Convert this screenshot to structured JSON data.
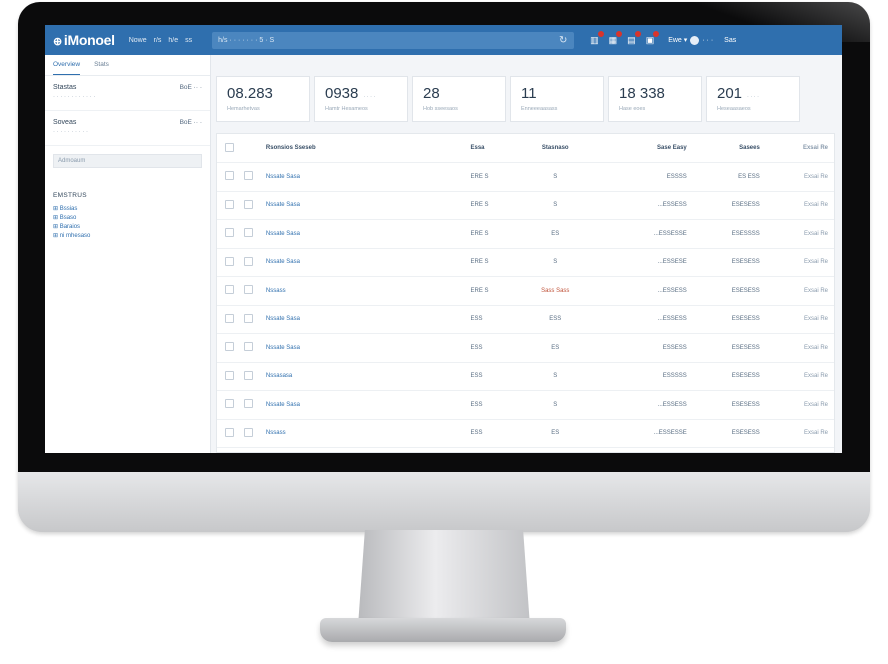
{
  "topbar": {
    "logo": "iMonoel",
    "nav": [
      "Nowe",
      "r/s",
      "h/e",
      "ss"
    ],
    "search_text": "h/s  · · · · · ·  ·  5 · S",
    "icons": [
      {
        "name": "chart-icon",
        "label": "",
        "badge": true
      },
      {
        "name": "grid-icon",
        "label": "",
        "badge": true
      },
      {
        "name": "bell-icon",
        "label": "",
        "badge": true
      },
      {
        "name": "mail-icon",
        "label": "",
        "badge": true
      }
    ],
    "user_label": "Ewe ▾",
    "user_name": "· · ·",
    "extra": "Sas"
  },
  "sidebar": {
    "tabs": [
      "Overview",
      "Stats"
    ],
    "items": [
      {
        "title": "Stastas",
        "sub": "· · · · · · ·  ·  · · · ·",
        "value": "BoE ·· ·"
      },
      {
        "title": "Soveas",
        "sub": "· · · · · · · · · ·",
        "value": "BoE ·· ·"
      }
    ],
    "filter_placeholder": "Admoaum",
    "section": "EMSTRUS",
    "links": [
      "Bssias",
      "Bsaso",
      "Baraios",
      "ni mhesaso"
    ]
  },
  "cards": [
    {
      "num": "08.283",
      "label": "Hemarhetvas",
      "sub": ""
    },
    {
      "num": "0938",
      "label": "Hamtr Hesameos",
      "sub": "· · · ·"
    },
    {
      "num": "28",
      "label": "Hob sseesaos",
      "sub": ""
    },
    {
      "num": "11",
      "label": "Enneeeaasass",
      "sub": ""
    },
    {
      "num": "18 338",
      "label": "Hase eoes",
      "sub": ""
    },
    {
      "num": "201",
      "label": "Heseaasaeos",
      "sub": "· · · ·"
    }
  ],
  "table": {
    "headers": [
      "Rsonsios Sseseb",
      "Essa",
      "Stasnaso",
      "Sase Easy",
      "Sasees",
      "Exsai Re"
    ],
    "rows": [
      {
        "name": "Nssate Sasa",
        "a": "ERE S",
        "b": "S",
        "c": "ESSSS",
        "d": "ES ESS",
        "e": "Exsai Re",
        "red": false
      },
      {
        "name": "Nssate Sasa",
        "a": "ERE S",
        "b": "S",
        "c": "...ESSESS",
        "d": "ESESESS",
        "e": "Exsai Re",
        "red": false
      },
      {
        "name": "Nssate Sasa",
        "a": "ERE S",
        "b": "ES",
        "c": "...ESSESSE",
        "d": "ESESSSS",
        "e": "Exsai Re",
        "red": false
      },
      {
        "name": "Nssate Sasa",
        "a": "ERE S",
        "b": "S",
        "c": "...ESSESE",
        "d": "ESESESS",
        "e": "Exsai Re",
        "red": false
      },
      {
        "name": "Nssass",
        "a": "ERE S",
        "b": "Sass Sass",
        "c": "...ESSESS",
        "d": "ESESESS",
        "e": "Exsai Re",
        "red": true
      },
      {
        "name": "Nssate Sasa",
        "a": "ESS",
        "b": "ESS",
        "c": "...ESSESS",
        "d": "ESESESS",
        "e": "Exsai Re",
        "red": false
      },
      {
        "name": "Nssate Sasa",
        "a": "ESS",
        "b": "ES",
        "c": "ESSESS",
        "d": "ESESESS",
        "e": "Exsai Re",
        "red": false
      },
      {
        "name": "Nssasasa",
        "a": "ESS",
        "b": "S",
        "c": "ESSSSS",
        "d": "ESESESS",
        "e": "Exsai Re",
        "red": false
      },
      {
        "name": "Nssate Sasa",
        "a": "ESS",
        "b": "S",
        "c": "...ESSESS",
        "d": "ESESESS",
        "e": "Exsai Re",
        "red": false
      },
      {
        "name": "Nssass",
        "a": "ESS",
        "b": "ES",
        "c": "...ESSESSE",
        "d": "ESESESS",
        "e": "Exsai Re",
        "red": false
      }
    ]
  },
  "colors": {
    "accent": "#2f6fae",
    "badge": "#d9342b",
    "warn": "#c0533a"
  }
}
